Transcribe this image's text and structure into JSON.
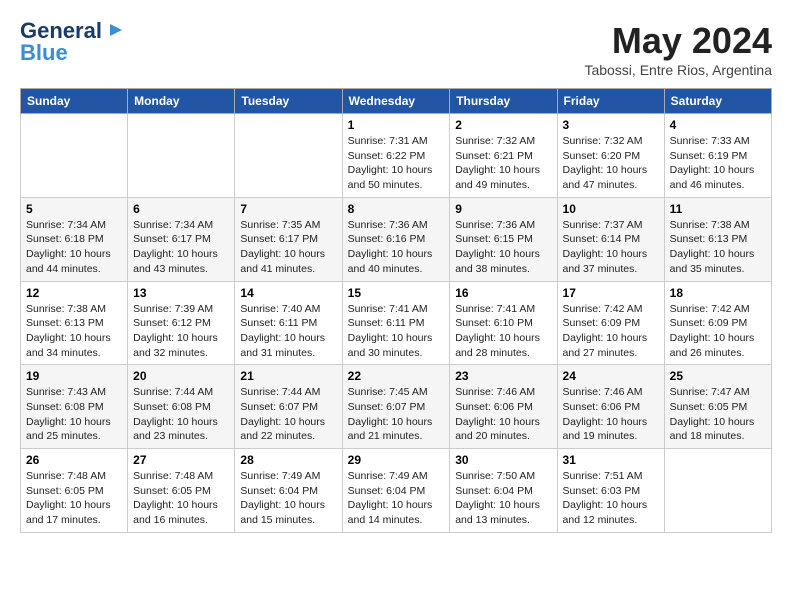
{
  "header": {
    "logo_line1": "General",
    "logo_line2": "Blue",
    "month_year": "May 2024",
    "location": "Tabossi, Entre Rios, Argentina"
  },
  "weekdays": [
    "Sunday",
    "Monday",
    "Tuesday",
    "Wednesday",
    "Thursday",
    "Friday",
    "Saturday"
  ],
  "weeks": [
    [
      {
        "day": "",
        "info": ""
      },
      {
        "day": "",
        "info": ""
      },
      {
        "day": "",
        "info": ""
      },
      {
        "day": "1",
        "info": "Sunrise: 7:31 AM\nSunset: 6:22 PM\nDaylight: 10 hours\nand 50 minutes."
      },
      {
        "day": "2",
        "info": "Sunrise: 7:32 AM\nSunset: 6:21 PM\nDaylight: 10 hours\nand 49 minutes."
      },
      {
        "day": "3",
        "info": "Sunrise: 7:32 AM\nSunset: 6:20 PM\nDaylight: 10 hours\nand 47 minutes."
      },
      {
        "day": "4",
        "info": "Sunrise: 7:33 AM\nSunset: 6:19 PM\nDaylight: 10 hours\nand 46 minutes."
      }
    ],
    [
      {
        "day": "5",
        "info": "Sunrise: 7:34 AM\nSunset: 6:18 PM\nDaylight: 10 hours\nand 44 minutes."
      },
      {
        "day": "6",
        "info": "Sunrise: 7:34 AM\nSunset: 6:17 PM\nDaylight: 10 hours\nand 43 minutes."
      },
      {
        "day": "7",
        "info": "Sunrise: 7:35 AM\nSunset: 6:17 PM\nDaylight: 10 hours\nand 41 minutes."
      },
      {
        "day": "8",
        "info": "Sunrise: 7:36 AM\nSunset: 6:16 PM\nDaylight: 10 hours\nand 40 minutes."
      },
      {
        "day": "9",
        "info": "Sunrise: 7:36 AM\nSunset: 6:15 PM\nDaylight: 10 hours\nand 38 minutes."
      },
      {
        "day": "10",
        "info": "Sunrise: 7:37 AM\nSunset: 6:14 PM\nDaylight: 10 hours\nand 37 minutes."
      },
      {
        "day": "11",
        "info": "Sunrise: 7:38 AM\nSunset: 6:13 PM\nDaylight: 10 hours\nand 35 minutes."
      }
    ],
    [
      {
        "day": "12",
        "info": "Sunrise: 7:38 AM\nSunset: 6:13 PM\nDaylight: 10 hours\nand 34 minutes."
      },
      {
        "day": "13",
        "info": "Sunrise: 7:39 AM\nSunset: 6:12 PM\nDaylight: 10 hours\nand 32 minutes."
      },
      {
        "day": "14",
        "info": "Sunrise: 7:40 AM\nSunset: 6:11 PM\nDaylight: 10 hours\nand 31 minutes."
      },
      {
        "day": "15",
        "info": "Sunrise: 7:41 AM\nSunset: 6:11 PM\nDaylight: 10 hours\nand 30 minutes."
      },
      {
        "day": "16",
        "info": "Sunrise: 7:41 AM\nSunset: 6:10 PM\nDaylight: 10 hours\nand 28 minutes."
      },
      {
        "day": "17",
        "info": "Sunrise: 7:42 AM\nSunset: 6:09 PM\nDaylight: 10 hours\nand 27 minutes."
      },
      {
        "day": "18",
        "info": "Sunrise: 7:42 AM\nSunset: 6:09 PM\nDaylight: 10 hours\nand 26 minutes."
      }
    ],
    [
      {
        "day": "19",
        "info": "Sunrise: 7:43 AM\nSunset: 6:08 PM\nDaylight: 10 hours\nand 25 minutes."
      },
      {
        "day": "20",
        "info": "Sunrise: 7:44 AM\nSunset: 6:08 PM\nDaylight: 10 hours\nand 23 minutes."
      },
      {
        "day": "21",
        "info": "Sunrise: 7:44 AM\nSunset: 6:07 PM\nDaylight: 10 hours\nand 22 minutes."
      },
      {
        "day": "22",
        "info": "Sunrise: 7:45 AM\nSunset: 6:07 PM\nDaylight: 10 hours\nand 21 minutes."
      },
      {
        "day": "23",
        "info": "Sunrise: 7:46 AM\nSunset: 6:06 PM\nDaylight: 10 hours\nand 20 minutes."
      },
      {
        "day": "24",
        "info": "Sunrise: 7:46 AM\nSunset: 6:06 PM\nDaylight: 10 hours\nand 19 minutes."
      },
      {
        "day": "25",
        "info": "Sunrise: 7:47 AM\nSunset: 6:05 PM\nDaylight: 10 hours\nand 18 minutes."
      }
    ],
    [
      {
        "day": "26",
        "info": "Sunrise: 7:48 AM\nSunset: 6:05 PM\nDaylight: 10 hours\nand 17 minutes."
      },
      {
        "day": "27",
        "info": "Sunrise: 7:48 AM\nSunset: 6:05 PM\nDaylight: 10 hours\nand 16 minutes."
      },
      {
        "day": "28",
        "info": "Sunrise: 7:49 AM\nSunset: 6:04 PM\nDaylight: 10 hours\nand 15 minutes."
      },
      {
        "day": "29",
        "info": "Sunrise: 7:49 AM\nSunset: 6:04 PM\nDaylight: 10 hours\nand 14 minutes."
      },
      {
        "day": "30",
        "info": "Sunrise: 7:50 AM\nSunset: 6:04 PM\nDaylight: 10 hours\nand 13 minutes."
      },
      {
        "day": "31",
        "info": "Sunrise: 7:51 AM\nSunset: 6:03 PM\nDaylight: 10 hours\nand 12 minutes."
      },
      {
        "day": "",
        "info": ""
      }
    ]
  ]
}
